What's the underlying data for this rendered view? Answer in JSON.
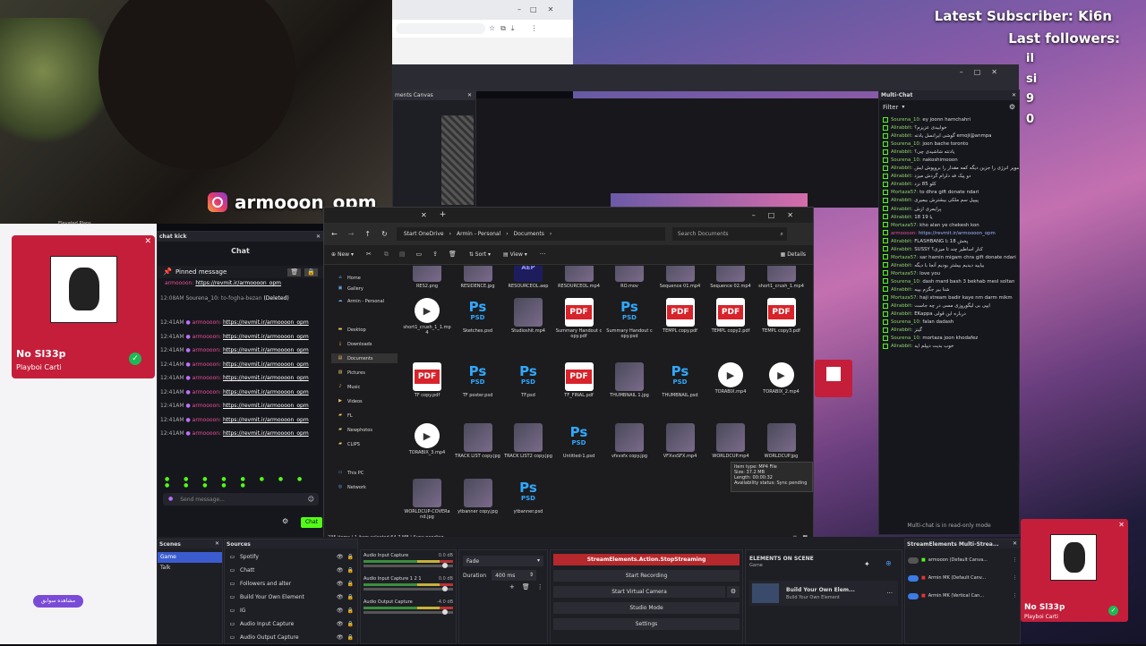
{
  "overlay": {
    "latest_subscriber": "Latest Subscriber: Ki6n",
    "last_followers_label": "Last followers:",
    "followers": [
      "il",
      "si",
      "9",
      "0"
    ],
    "instagram_handle": "armooon_opm"
  },
  "browser": {
    "title": ""
  },
  "docs_canvas": {
    "title": "ments Canvas"
  },
  "spotify_card": {
    "elevated": "Elevated Plans",
    "track": "No Sl33p",
    "artist": "Playboi Carti",
    "button": "مشاهده سوابق"
  },
  "spotify_card_right": {
    "track": "No Sl33p",
    "artist": "Playboi Carti"
  },
  "kick_chat": {
    "window_title": "chat kick",
    "tab": "Chat",
    "pinned_label": "Pinned message",
    "pinned_user": "armoooon:",
    "pinned_link": "https://revmit.ir/armoooon_opm",
    "deleted_line": {
      "time": "12:08AM",
      "user": "Sourena_10:",
      "text": "to-fogha-bezan",
      "tag": "(Deleted)"
    },
    "lines": [
      {
        "time": "12:41AM",
        "user": "armoooon:",
        "link": "https://revmit.ir/armoooon_opm"
      },
      {
        "time": "12:41AM",
        "user": "armoooon:",
        "link": "https://revmit.ir/armoooon_opm"
      },
      {
        "time": "12:41AM",
        "user": "armoooon:",
        "link": "https://revmit.ir/armoooon_opm"
      },
      {
        "time": "12:41AM",
        "user": "armoooon:",
        "link": "https://revmit.ir/armoooon_opm"
      },
      {
        "time": "12:41AM",
        "user": "armoooon:",
        "link": "https://revmit.ir/armoooon_opm"
      },
      {
        "time": "12:41AM",
        "user": "armoooon:",
        "link": "https://revmit.ir/armoooon_opm"
      },
      {
        "time": "12:41AM",
        "user": "armoooon:",
        "link": "https://revmit.ir/armoooon_opm"
      },
      {
        "time": "12:41AM",
        "user": "armoooon:",
        "link": "https://revmit.ir/armoooon_opm"
      },
      {
        "time": "12:41AM",
        "user": "armoooon:",
        "link": "https://revmit.ir/armoooon_opm"
      }
    ],
    "input_placeholder": "Send message...",
    "chat_button": "Chat"
  },
  "explorer": {
    "breadcrumb": [
      "Start OneDrive",
      "Armin - Personal",
      "Documents"
    ],
    "search_placeholder": "Search Documents",
    "toolbar": {
      "new": "New",
      "sort": "Sort",
      "view": "View",
      "details": "Details"
    },
    "nav": [
      "Home",
      "Gallery",
      "Armin - Personal",
      "Desktop",
      "Downloads",
      "Documents",
      "Pictures",
      "Music",
      "Videos",
      "FL",
      "Newphotos",
      "CLIPS",
      "This PC",
      "Network"
    ],
    "files": [
      {
        "name": "RES2.png",
        "type": "img"
      },
      {
        "name": "RESIDENCE.jpg",
        "type": "img"
      },
      {
        "name": "RESOURCEOL.aep",
        "type": "aep"
      },
      {
        "name": "RESOURCEOL.mp4",
        "type": "img"
      },
      {
        "name": "RO.mov",
        "type": "img"
      },
      {
        "name": "Sequence 01.mp4",
        "type": "img"
      },
      {
        "name": "Sequence 02.mp4",
        "type": "img"
      },
      {
        "name": "short1_crush_1.mp4",
        "type": "img"
      },
      {
        "name": "short1_crush_1_1.mp4",
        "type": "vid"
      },
      {
        "name": "Sketches.psd",
        "type": "ps"
      },
      {
        "name": "Studioshit.mp4",
        "type": "img"
      },
      {
        "name": "Summary Handout copy.pdf",
        "type": "pdf"
      },
      {
        "name": "Summary Handout copy.psd",
        "type": "ps"
      },
      {
        "name": "TEMPL copy.pdf",
        "type": "pdf"
      },
      {
        "name": "TEMPL copy2.pdf",
        "type": "pdf"
      },
      {
        "name": "TEMPL copy3.pdf",
        "type": "pdf"
      },
      {
        "name": "TF copy.pdf",
        "type": "pdf"
      },
      {
        "name": "TF poster.psd",
        "type": "ps"
      },
      {
        "name": "TF.psd",
        "type": "ps"
      },
      {
        "name": "TF_FINAL.pdf",
        "type": "pdf"
      },
      {
        "name": "THUMBNAIL 1.jpg",
        "type": "img"
      },
      {
        "name": "THUMBNAIL.psd",
        "type": "ps"
      },
      {
        "name": "TORABIX.mp4",
        "type": "vid"
      },
      {
        "name": "TORABIX_2.mp4",
        "type": "vid"
      },
      {
        "name": "TORABIX_3.mp4",
        "type": "vid"
      },
      {
        "name": "TRACK LIST copy.jpg",
        "type": "img"
      },
      {
        "name": "TRACK LIST2 copy.jpg",
        "type": "img"
      },
      {
        "name": "Untitled-1.psd",
        "type": "ps"
      },
      {
        "name": "vfxvsfx copy.jpg",
        "type": "img"
      },
      {
        "name": "VFXvsSFX.mp4",
        "type": "img"
      },
      {
        "name": "WORLDCUP.mp4",
        "type": "img"
      },
      {
        "name": "WORLDCUP.jpg",
        "type": "img"
      },
      {
        "name": "WORLDCUP-COVERand.jpg",
        "type": "img"
      },
      {
        "name": "ytbanner copy.jpg",
        "type": "img"
      },
      {
        "name": "ytbanner.psd",
        "type": "ps"
      }
    ],
    "tooltip": [
      "Item type: MP4 File",
      "Size: 37.2 MB",
      "Length: 00:00:32",
      "Availability status: Sync pending"
    ],
    "status": "235 items | 1 item selected 64.7 MB | Sync pending"
  },
  "multichat": {
    "title": "Multi-Chat",
    "filter": "Filter",
    "footer": "Multi-chat is in read-only mode",
    "messages": [
      {
        "user": "Sourena_10:",
        "text": "ey joonn hamchahri"
      },
      {
        "user": "Alirabbit:",
        "text": "خوابیدی عزیزم؟"
      },
      {
        "user": "Alirabbit:",
        "text": "گوشی ایرانسل یادته emoji@anmpa"
      },
      {
        "user": "Sourena_10:",
        "text": "joon bache toronto"
      },
      {
        "user": "Alirabbit:",
        "text": "یادتته شاشیدی چی؟"
      },
      {
        "user": "Sourena_10:",
        "text": "nakoshimooon"
      },
      {
        "user": "Alirabbit:",
        "text": "ده سوپر انرژی را جزین دیگه کمه مقدار را بروپوش ایش"
      },
      {
        "user": "Alirabbit:",
        "text": "دو پیک فد دلرام گردش میزد"
      },
      {
        "user": "Alirabbit:",
        "text": "کلو 85 نزد"
      },
      {
        "user": "Mortaza57:",
        "text": "to dhra gift donate ndari"
      },
      {
        "user": "Alirabbit:",
        "text": "پیپیل سم ملکی بیشترش بیمیری"
      },
      {
        "user": "Alirabbit:",
        "text": "پرایمری ازش"
      },
      {
        "user": "Alirabbit:",
        "text": "18 یا 19"
      },
      {
        "user": "Mortaza57:",
        "text": "kho alan ye chekesh kon"
      },
      {
        "user": "armoooon:",
        "text": "https://revmit.ir/armoooon_opm"
      },
      {
        "user": "Alirabbit:",
        "text": "FLASHBANG پخش 18 تا"
      },
      {
        "user": "Alirabbit:",
        "text": "SUSSY کنار اساطیر چند تا میزی؟"
      },
      {
        "user": "Mortaza57:",
        "text": "sar hamin migam chra gift donate ndari"
      },
      {
        "user": "Alirabbit:",
        "text": "بیایید دیدیم بیشتر بودیم آنجا با دیگه"
      },
      {
        "user": "Mortaza57:",
        "text": "love you"
      },
      {
        "user": "Sourena_10:",
        "text": "dash mard bash 3 bekhab mesl soltan"
      },
      {
        "user": "Alirabbit:",
        "text": "شنا بیر جگزم بپیه"
      },
      {
        "user": "Mortaza57:",
        "text": "haji stream badir kaye nm darm mikm"
      },
      {
        "user": "Alirabbit:",
        "text": "ایپی بی لیگوروزی مسی در چه جاست"
      },
      {
        "user": "Alirabbit:",
        "text": "EKappa درباره این قولی"
      },
      {
        "user": "Sourena_10:",
        "text": "falan dadash"
      },
      {
        "user": "Alirabbit:",
        "text": "گینز"
      },
      {
        "user": "Sourena_10:",
        "text": "mortaza joon khodafez"
      },
      {
        "user": "Alirabbit:",
        "text": "خوب بدیت دیپلم اید"
      }
    ]
  },
  "obs": {
    "scenes_title": "Scenes",
    "scenes": [
      "Game",
      "Talk"
    ],
    "sources_title": "Sources",
    "sources": [
      "Spotify",
      "Chatt",
      "Followers and alter",
      "Build Your Own Element",
      "IG",
      "Audio Input Capture",
      "Audio Output Capture"
    ],
    "mixer": [
      {
        "name": "Audio Input Capture",
        "db": "0.0 dB"
      },
      {
        "name": "Audio Input Capture 1 2 1",
        "db": "0.0 dB"
      },
      {
        "name": "Audio Output Capture",
        "db": "-4.0 dB"
      }
    ],
    "transition": "Fade",
    "duration_label": "Duration",
    "duration_value": "400 ms",
    "controls": {
      "stop_action": "StreamElements.Action.StopStreaming",
      "start_recording": "Start Recording",
      "start_virtual_camera": "Start Virtual Camera",
      "studio_mode": "Studio Mode",
      "settings": "Settings"
    },
    "elements_title": "ELEMENTS ON SCENE",
    "elements_scene": "Game",
    "element_name": "Build Your Own Elem...",
    "element_sub": "Build Your Own Element",
    "multistream_title": "StreamElements Multi-Strea...",
    "multistream": [
      {
        "name": "armooon (Default Canva..."
      },
      {
        "name": "Armin MK (Default Canv..."
      },
      {
        "name": "Armin MK (Vertical Can..."
      }
    ]
  },
  "colors": {
    "accent_green": "#53fc18",
    "link_white": "#ffffff",
    "user_pink": "#e94f9a",
    "pdf_red": "#d8232a",
    "ps_blue": "#31a8ff"
  }
}
